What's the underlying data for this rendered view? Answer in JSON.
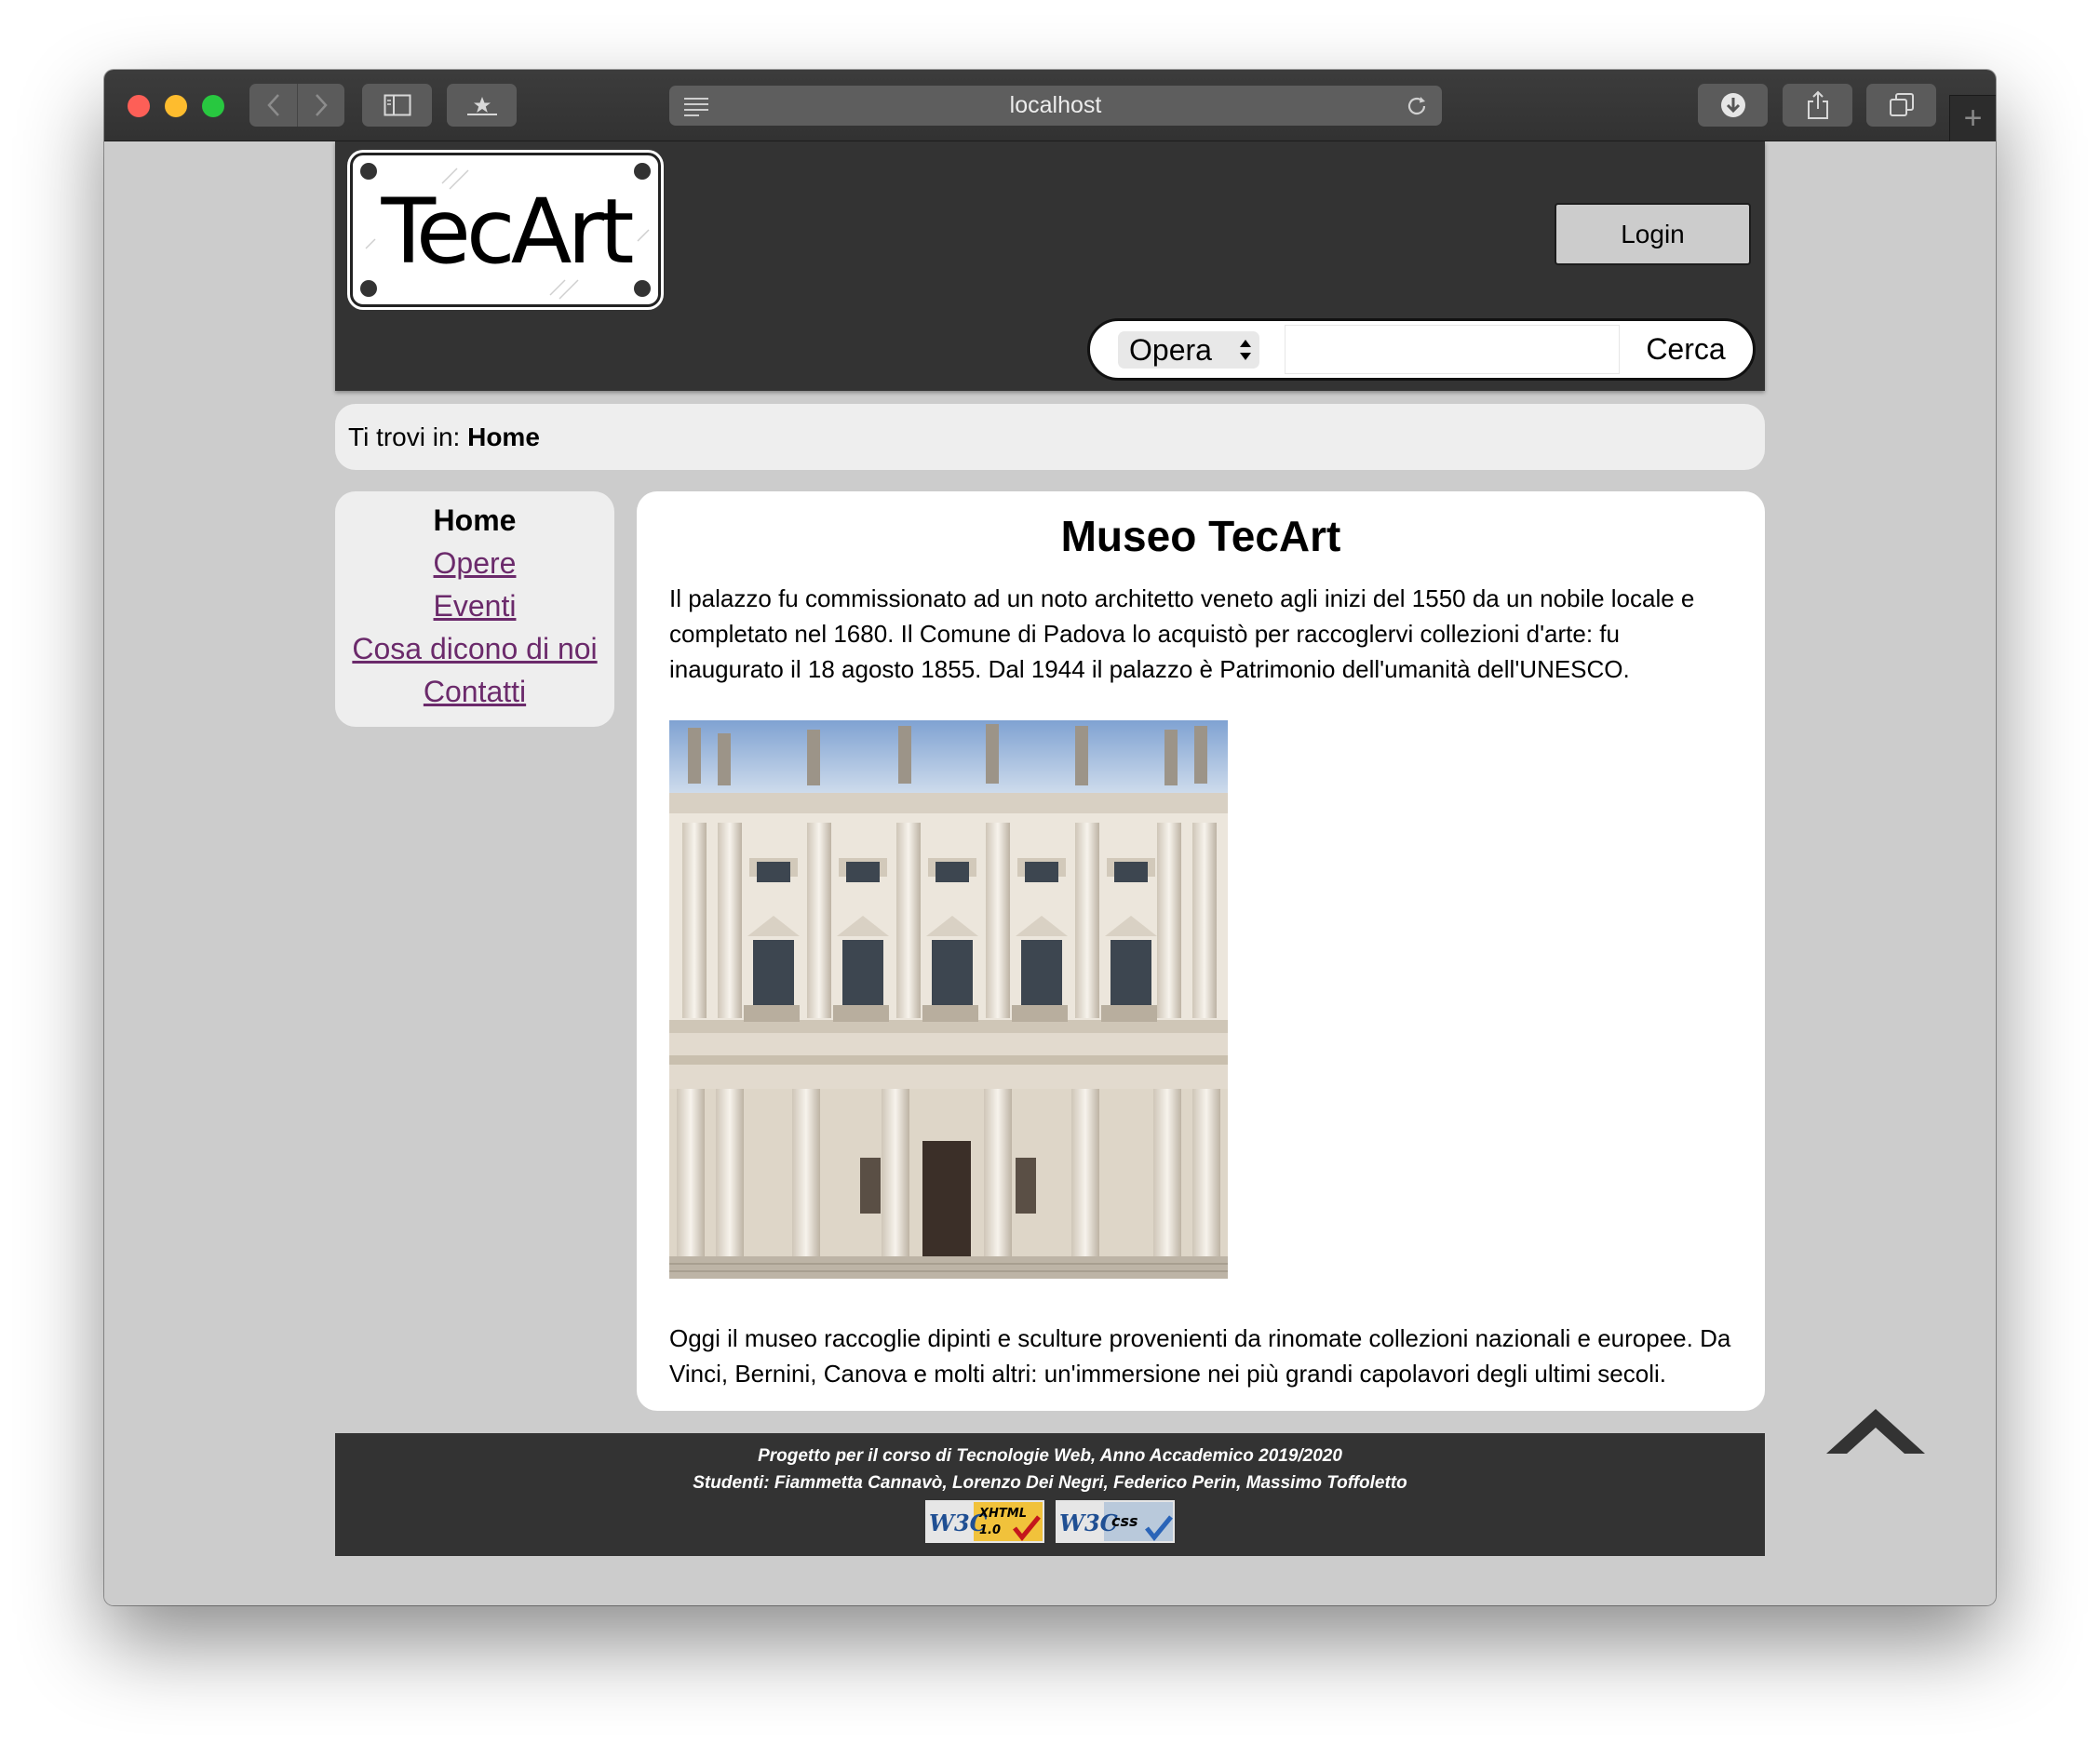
{
  "browser": {
    "url": "localhost"
  },
  "header": {
    "logo_text": "TecArt",
    "login_label": "Login",
    "search": {
      "select_value": "Opera",
      "input_value": "",
      "button_label": "Cerca"
    }
  },
  "breadcrumb": {
    "prefix": "Ti trovi in: ",
    "current": "Home"
  },
  "menu": {
    "items": [
      {
        "label": "Home",
        "current": true
      },
      {
        "label": "Opere"
      },
      {
        "label": "Eventi"
      },
      {
        "label": "Cosa dicono di noi"
      },
      {
        "label": "Contatti"
      }
    ]
  },
  "main": {
    "title": "Museo TecArt",
    "paragraph1": "Il palazzo fu commissionato ad un noto architetto veneto agli inizi del 1550 da un nobile locale e completato nel 1680. Il Comune di Padova lo acquistò per raccoglervi collezioni d'arte: fu inaugurato il 18 agosto 1855. Dal 1944 il palazzo è Patrimonio dell'umanità dell'UNESCO.",
    "paragraph2": "Oggi il museo raccoglie dipinti e sculture provenienti da rinomate collezioni nazionali e europee. Da Vinci, Bernini, Canova e molti altri: un'immersione nei più grandi capolavori degli ultimi secoli."
  },
  "footer": {
    "line1": "Progetto per il corso di Tecnologie Web, Anno Accademico 2019/2020",
    "line2": "Studenti: Fiammetta Cannavò, Lorenzo Dei Negri, Federico Perin, Massimo Toffoletto",
    "badge_xhtml": {
      "brand": "W3C",
      "label": "XHTML",
      "version": "1.0"
    },
    "badge_css": {
      "brand": "W3C",
      "label": "css"
    }
  },
  "icons": {
    "back": "chevron-left-icon",
    "forward": "chevron-right-icon",
    "sidebar": "sidebar-icon",
    "bookmarks": "star-icon",
    "reader": "reader-icon",
    "reload": "reload-icon",
    "download": "download-icon",
    "share": "share-icon",
    "tabs": "tabs-icon",
    "new_tab": "plus-icon",
    "back_to_top": "chevron-up-icon"
  },
  "colors": {
    "page_bg": "#cccccc",
    "header_bg": "#333333",
    "panel_bg": "#eeeeee",
    "link": "#6b2a6b"
  }
}
